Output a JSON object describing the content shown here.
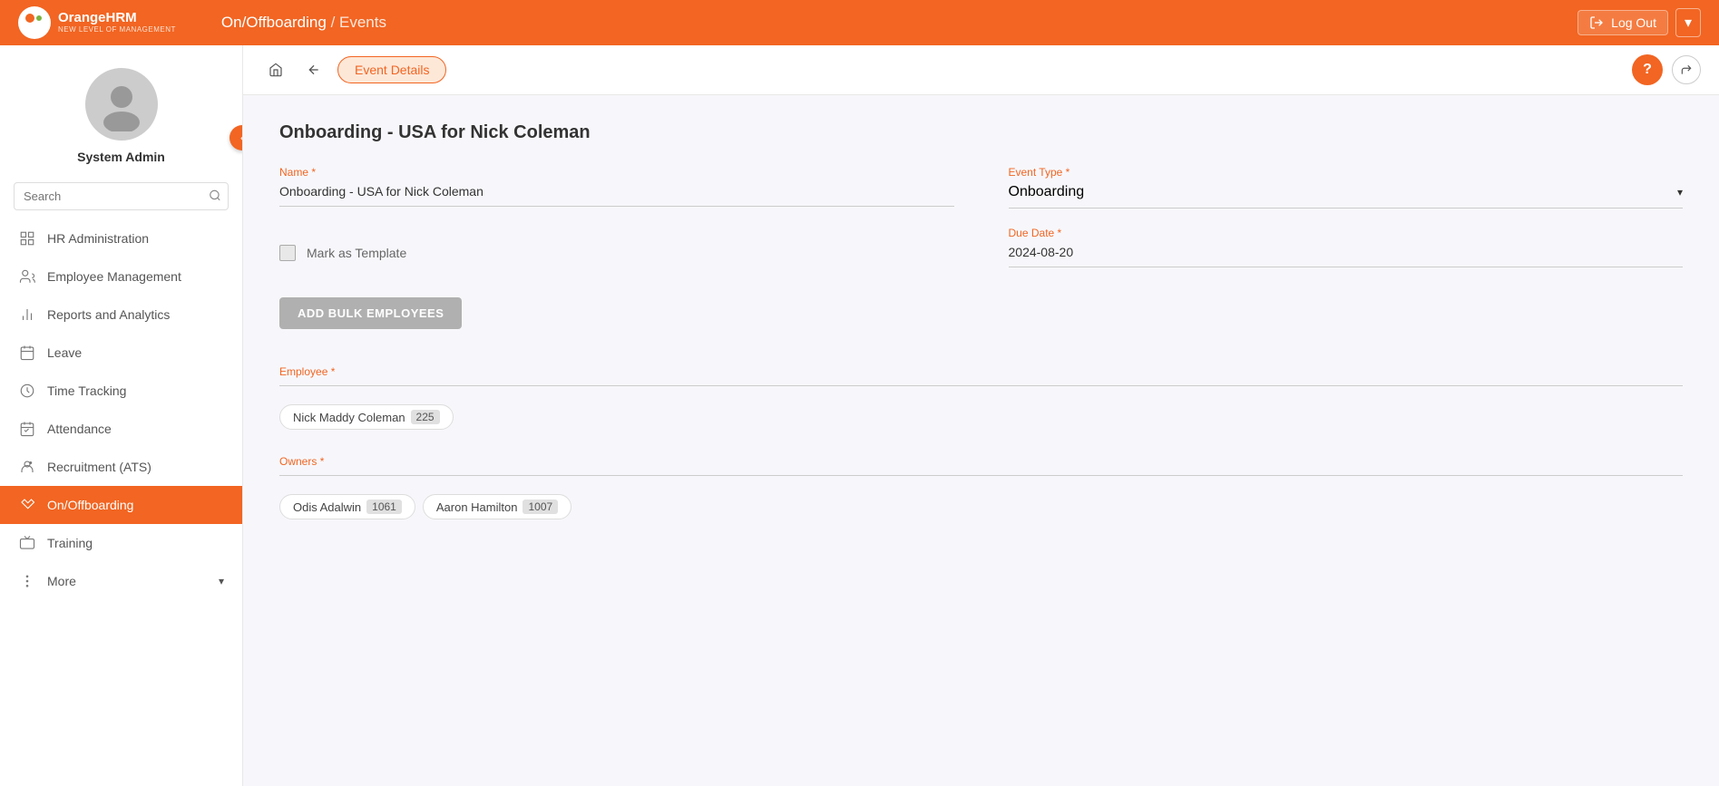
{
  "app": {
    "logo_text": "OrangeHRM",
    "logo_tagline": "NEW LEVEL OF MANAGEMENT"
  },
  "header": {
    "breadcrumb_module": "On/Offboarding",
    "breadcrumb_separator": " / ",
    "breadcrumb_page": "Events",
    "logout_label": "Log Out"
  },
  "subheader": {
    "active_tab": "Event Details"
  },
  "sidebar": {
    "user_name": "System Admin",
    "search_placeholder": "Search",
    "nav_items": [
      {
        "id": "hr-admin",
        "label": "HR Administration",
        "icon": "grid-icon"
      },
      {
        "id": "employee-mgmt",
        "label": "Employee Management",
        "icon": "people-icon"
      },
      {
        "id": "reports",
        "label": "Reports and Analytics",
        "icon": "chart-icon"
      },
      {
        "id": "leave",
        "label": "Leave",
        "icon": "calendar-icon"
      },
      {
        "id": "time-tracking",
        "label": "Time Tracking",
        "icon": "clock-icon"
      },
      {
        "id": "attendance",
        "label": "Attendance",
        "icon": "calendar2-icon"
      },
      {
        "id": "recruitment",
        "label": "Recruitment (ATS)",
        "icon": "person-icon"
      },
      {
        "id": "onoffboarding",
        "label": "On/Offboarding",
        "icon": "handshake-icon",
        "active": true
      },
      {
        "id": "training",
        "label": "Training",
        "icon": "training-icon"
      }
    ],
    "more_label": "More"
  },
  "form": {
    "title": "Onboarding - USA for Nick Coleman",
    "name_label": "Name",
    "name_required": true,
    "name_value": "Onboarding - USA for Nick Coleman",
    "event_type_label": "Event Type",
    "event_type_required": true,
    "event_type_value": "Onboarding",
    "mark_template_label": "Mark as Template",
    "due_date_label": "Due Date",
    "due_date_required": true,
    "due_date_value": "2024-08-20",
    "add_bulk_label": "ADD BULK EMPLOYEES",
    "employee_label": "Employee",
    "employee_required": true,
    "employees": [
      {
        "name": "Nick Maddy Coleman",
        "id": "225"
      }
    ],
    "owners_label": "Owners",
    "owners_required": true,
    "owners": [
      {
        "name": "Odis Adalwin",
        "id": "1061"
      },
      {
        "name": "Aaron Hamilton",
        "id": "1007"
      }
    ]
  }
}
